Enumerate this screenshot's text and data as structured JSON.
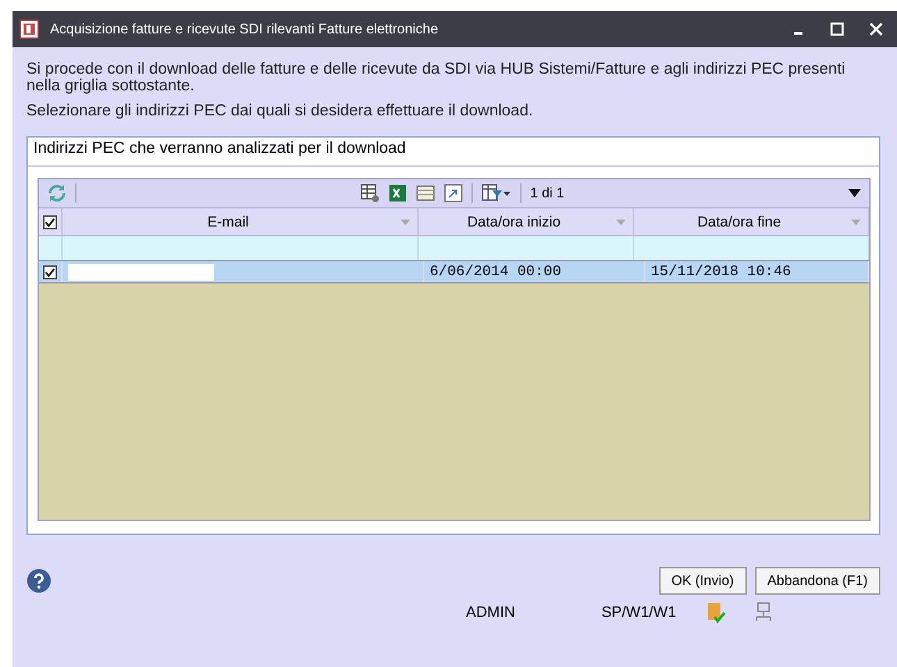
{
  "window": {
    "title": "Acquisizione fatture e ricevute SDI rilevanti Fatture elettroniche"
  },
  "intro": [
    "Si procede con il download delle fatture e delle ricevute da SDI via HUB Sistemi/Fatture e agli indirizzi PEC presenti nella griglia sottostante.",
    "Selezionare gli indirizzi PEC dai quali si desidera effettuare il download."
  ],
  "panel": {
    "title": "Indirizzi PEC che verranno analizzati per il download"
  },
  "grid": {
    "pager": "1 di 1",
    "select_all": true,
    "columns": [
      {
        "label": "E-mail"
      },
      {
        "label": "Data/ora inizio"
      },
      {
        "label": "Data/ora fine"
      }
    ],
    "rows": [
      {
        "checked": true,
        "selected": true,
        "cells": [
          {
            "kind": "redacted"
          },
          {
            "kind": "text",
            "text": "6/06/2014 00:00"
          },
          {
            "kind": "text",
            "text": "15/11/2018 10:46"
          }
        ]
      }
    ]
  },
  "buttons": [
    "OK (Invio)",
    "Abbandona (F1)"
  ],
  "status_bar": {
    "user": "ADMIN",
    "path": "SP/W1/W1"
  }
}
